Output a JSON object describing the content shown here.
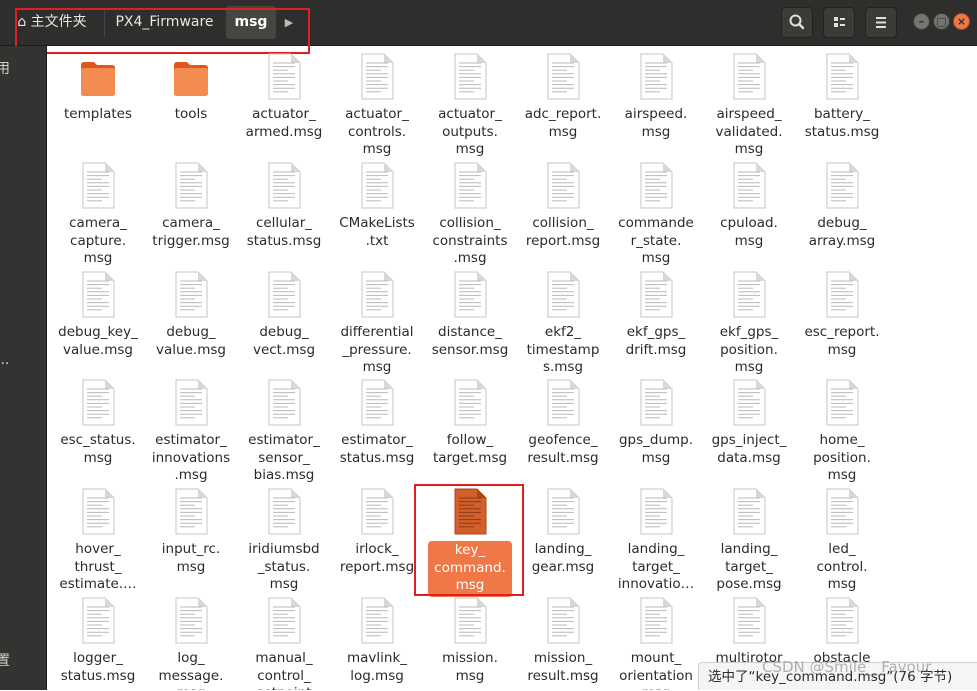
{
  "header": {
    "breadcrumbs": [
      {
        "label": "主文件夹"
      },
      {
        "label": "PX4_Firmware"
      },
      {
        "label": "msg"
      }
    ],
    "icons": {
      "home": "home-icon",
      "forward": "chevron-right-icon",
      "search": "search-icon",
      "view": "view-options-icon",
      "menu": "hamburger-menu-icon"
    }
  },
  "sidebar": {
    "visible_glyphs": [
      "用",
      "...",
      "置"
    ]
  },
  "files": [
    {
      "label": "templates",
      "type": "folder"
    },
    {
      "label": "tools",
      "type": "folder"
    },
    {
      "label": "actuator_\narmed.msg",
      "type": "document"
    },
    {
      "label": "actuator_\ncontrols.\nmsg",
      "type": "document"
    },
    {
      "label": "actuator_\noutputs.\nmsg",
      "type": "document"
    },
    {
      "label": "adc_report.\nmsg",
      "type": "document"
    },
    {
      "label": "airspeed.\nmsg",
      "type": "document"
    },
    {
      "label": "airspeed_\nvalidated.\nmsg",
      "type": "document"
    },
    {
      "label": "battery_\nstatus.msg",
      "type": "document"
    },
    {
      "label": "camera_\ncapture.\nmsg",
      "type": "document"
    },
    {
      "label": "camera_\ntrigger.msg",
      "type": "document"
    },
    {
      "label": "cellular_\nstatus.msg",
      "type": "document"
    },
    {
      "label": "CMakeLists\n.txt",
      "type": "document"
    },
    {
      "label": "collision_\nconstraints\n.msg",
      "type": "document"
    },
    {
      "label": "collision_\nreport.msg",
      "type": "document"
    },
    {
      "label": "commande\nr_state.\nmsg",
      "type": "document"
    },
    {
      "label": "cpuload.\nmsg",
      "type": "document"
    },
    {
      "label": "debug_\narray.msg",
      "type": "document"
    },
    {
      "label": "debug_key_\nvalue.msg",
      "type": "document"
    },
    {
      "label": "debug_\nvalue.msg",
      "type": "document"
    },
    {
      "label": "debug_\nvect.msg",
      "type": "document"
    },
    {
      "label": "differential\n_pressure.\nmsg",
      "type": "document"
    },
    {
      "label": "distance_\nsensor.msg",
      "type": "document"
    },
    {
      "label": "ekf2_\ntimestamp\ns.msg",
      "type": "document"
    },
    {
      "label": "ekf_gps_\ndrift.msg",
      "type": "document"
    },
    {
      "label": "ekf_gps_\nposition.\nmsg",
      "type": "document"
    },
    {
      "label": "esc_report.\nmsg",
      "type": "document"
    },
    {
      "label": "esc_status.\nmsg",
      "type": "document"
    },
    {
      "label": "estimator_\ninnovations\n.msg",
      "type": "document"
    },
    {
      "label": "estimator_\nsensor_\nbias.msg",
      "type": "document"
    },
    {
      "label": "estimator_\nstatus.msg",
      "type": "document"
    },
    {
      "label": "follow_\ntarget.msg",
      "type": "document"
    },
    {
      "label": "geofence_\nresult.msg",
      "type": "document"
    },
    {
      "label": "gps_dump.\nmsg",
      "type": "document"
    },
    {
      "label": "gps_inject_\ndata.msg",
      "type": "document"
    },
    {
      "label": "home_\nposition.\nmsg",
      "type": "document"
    },
    {
      "label": "hover_\nthrust_\nestimate.…",
      "type": "document"
    },
    {
      "label": "input_rc.\nmsg",
      "type": "document"
    },
    {
      "label": "iridiumsbd\n_status.\nmsg",
      "type": "document"
    },
    {
      "label": "irlock_\nreport.msg",
      "type": "document"
    },
    {
      "label": "key_\ncommand.\nmsg",
      "type": "document",
      "selected": true
    },
    {
      "label": "landing_\ngear.msg",
      "type": "document"
    },
    {
      "label": "landing_\ntarget_\ninnovatio…",
      "type": "document"
    },
    {
      "label": "landing_\ntarget_\npose.msg",
      "type": "document"
    },
    {
      "label": "led_\ncontrol.\nmsg",
      "type": "document"
    },
    {
      "label": "logger_\nstatus.msg",
      "type": "document"
    },
    {
      "label": "log_\nmessage.\nmsg",
      "type": "document"
    },
    {
      "label": "manual_\ncontrol_\nsetpoint",
      "type": "document"
    },
    {
      "label": "mavlink_\nlog.msg",
      "type": "document"
    },
    {
      "label": "mission.\nmsg",
      "type": "document"
    },
    {
      "label": "mission_\nresult.msg",
      "type": "document"
    },
    {
      "label": "mount_\norientation\nmsg",
      "type": "document"
    },
    {
      "label": "multirotor",
      "type": "document"
    },
    {
      "label": "obstacle",
      "type": "document"
    }
  ],
  "statusbar": {
    "text": "选中了“key_command.msg”(76 字节)"
  },
  "watermark": "CSDN @Smile__Favour",
  "colors": {
    "header_bg": "#2e2e2c",
    "sidebar_bg": "#333331",
    "accent_orange": "#f07746",
    "highlight_red": "#e02020"
  }
}
